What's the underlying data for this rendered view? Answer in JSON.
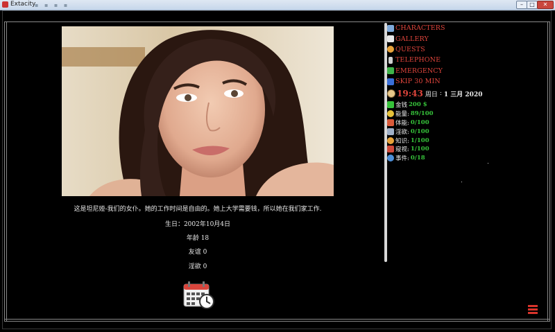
{
  "window": {
    "title": "Extacity"
  },
  "character": {
    "description": "这是坦尼娅-我们的女仆。她的工作时间是自由的。她上大学需要钱，所以她在我们家工作.",
    "birthday": "生日：2002年10月4日",
    "age": "年龄 18",
    "friendship": "友谊 0",
    "lust": "淫欲 0"
  },
  "menu": [
    {
      "label": "CHARACTERS",
      "icon": "characters-icon",
      "color": "#7fa9d9"
    },
    {
      "label": "GALLERY",
      "icon": "gallery-icon",
      "color": "#e8e8e8"
    },
    {
      "label": "QUESTS",
      "icon": "quests-icon",
      "color": "#e8a33a"
    },
    {
      "label": "TELEPHONE",
      "icon": "telephone-icon",
      "color": "#d0d0d0"
    },
    {
      "label": "EMERGENCY",
      "icon": "emergency-icon",
      "color": "#3fb34a"
    },
    {
      "label": "SKIP 30 MIN",
      "icon": "skip-icon",
      "color": "#3a6fd8"
    }
  ],
  "clock": {
    "time": "19:43",
    "weekday": "周日",
    "separator": ":",
    "date": "1 三月 2020"
  },
  "stats": [
    {
      "label": "金钱",
      "value": "200 $",
      "icon": "money-icon",
      "color": "#36c23a"
    },
    {
      "label": "能量:",
      "value": "89/100",
      "icon": "energy-icon",
      "color": "#e6c23a"
    },
    {
      "label": "体能:",
      "value": "0/100",
      "icon": "fitness-icon",
      "color": "#d85a3a"
    },
    {
      "label": "淫欲:",
      "value": "0/100",
      "icon": "lust-icon",
      "color": "#9fb0c8"
    },
    {
      "label": "知识:",
      "value": "1/100",
      "icon": "knowledge-icon",
      "color": "#e8a33a"
    },
    {
      "label": "窥视:",
      "value": "1/100",
      "icon": "peek-icon",
      "color": "#d04a3a"
    },
    {
      "label": "事件:",
      "value": "0/18",
      "icon": "events-icon",
      "color": "#4d8fd8"
    }
  ],
  "colors": {
    "accent": "#e0453c",
    "stat_value": "#36c23a",
    "background": "#000000"
  }
}
